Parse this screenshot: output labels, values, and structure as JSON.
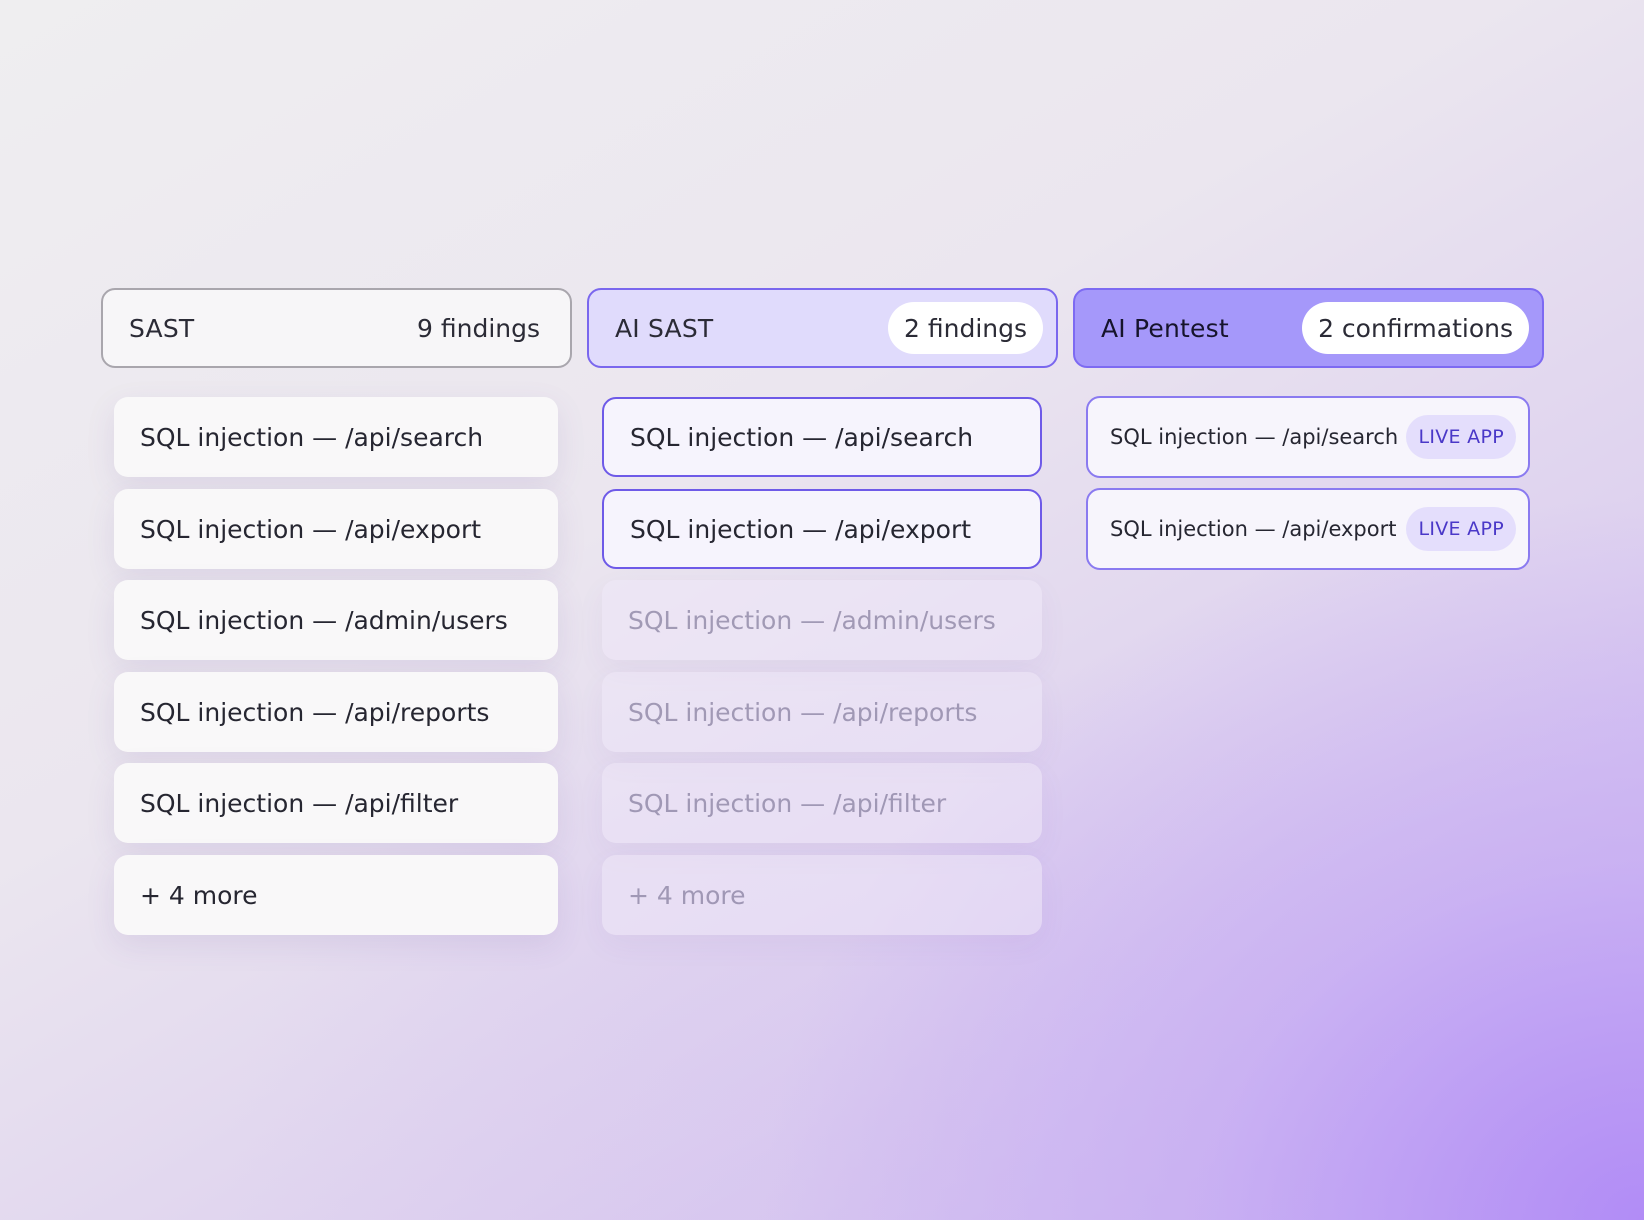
{
  "columns": {
    "sast": {
      "title": "SAST",
      "count": "9 findings",
      "items": [
        "SQL injection — /api/search",
        "SQL injection — /api/export",
        "SQL injection — /admin/users",
        "SQL injection — /api/reports",
        "SQL injection — /api/filter",
        "+ 4 more"
      ]
    },
    "ai_sast": {
      "title": "AI SAST",
      "count": "2 findings",
      "items": [
        "SQL injection — /api/search",
        "SQL injection — /api/export",
        "SQL injection — /admin/users",
        "SQL injection — /api/reports",
        "SQL injection — /api/filter",
        "+ 4 more"
      ]
    },
    "ai_pentest": {
      "title": "AI Pentest",
      "count": "2 confirmations",
      "items": [
        {
          "label": "SQL injection — /api/search",
          "badge": "LIVE APP"
        },
        {
          "label": "SQL injection — /api/export",
          "badge": "LIVE APP"
        }
      ]
    }
  },
  "colors": {
    "accent": "#7a67ee",
    "pentest_header": "#a598fa",
    "badge_text": "#4a38c8"
  }
}
